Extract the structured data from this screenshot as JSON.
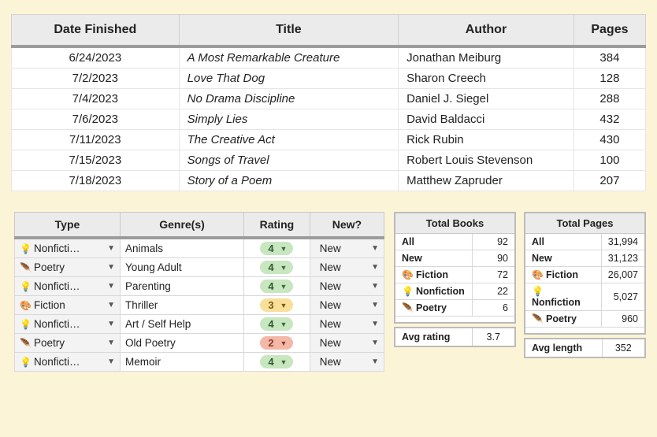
{
  "main_table": {
    "headers": {
      "date": "Date Finished",
      "title": "Title",
      "author": "Author",
      "pages": "Pages"
    },
    "rows": [
      {
        "date": "6/24/2023",
        "title": "A Most Remarkable Creature",
        "author": "Jonathan Meiburg",
        "pages": "384"
      },
      {
        "date": "7/2/2023",
        "title": "Love That Dog",
        "author": "Sharon Creech",
        "pages": "128"
      },
      {
        "date": "7/4/2023",
        "title": "No Drama Discipline",
        "author": "Daniel J. Siegel",
        "pages": "288"
      },
      {
        "date": "7/6/2023",
        "title": "Simply Lies",
        "author": "David Baldacci",
        "pages": "432"
      },
      {
        "date": "7/11/2023",
        "title": "The Creative Act",
        "author": "Rick Rubin",
        "pages": "430"
      },
      {
        "date": "7/15/2023",
        "title": "Songs of Travel",
        "author": "Robert Louis Stevenson",
        "pages": "100"
      },
      {
        "date": "7/18/2023",
        "title": "Story of a Poem",
        "author": "Matthew Zapruder",
        "pages": "207"
      }
    ]
  },
  "types_table": {
    "headers": {
      "type": "Type",
      "genre": "Genre(s)",
      "rating": "Rating",
      "new": "New?"
    },
    "rows": [
      {
        "icon": "💡",
        "type": "Nonficti…",
        "genre": "Animals",
        "rating": "4",
        "rclass": "r4",
        "new": "New"
      },
      {
        "icon": "🪶",
        "type": "Poetry",
        "genre": "Young Adult",
        "rating": "4",
        "rclass": "r4",
        "new": "New"
      },
      {
        "icon": "💡",
        "type": "Nonficti…",
        "genre": "Parenting",
        "rating": "4",
        "rclass": "r4",
        "new": "New"
      },
      {
        "icon": "🎨",
        "type": "Fiction",
        "genre": "Thriller",
        "rating": "3",
        "rclass": "r3",
        "new": "New"
      },
      {
        "icon": "💡",
        "type": "Nonficti…",
        "genre": "Art / Self Help",
        "rating": "4",
        "rclass": "r4",
        "new": "New"
      },
      {
        "icon": "🪶",
        "type": "Poetry",
        "genre": "Old Poetry",
        "rating": "2",
        "rclass": "r2",
        "new": "New"
      },
      {
        "icon": "💡",
        "type": "Nonficti…",
        "genre": "Memoir",
        "rating": "4",
        "rclass": "r4",
        "new": "New"
      }
    ]
  },
  "stats": {
    "books": {
      "header": "Total Books",
      "rows": [
        {
          "icon": "",
          "label": "All",
          "value": "92"
        },
        {
          "icon": "",
          "label": "New",
          "value": "90"
        },
        {
          "icon": "🎨",
          "label": "Fiction",
          "value": "72"
        },
        {
          "icon": "💡",
          "label": "Nonfiction",
          "value": "22"
        },
        {
          "icon": "🪶",
          "label": "Poetry",
          "value": "6"
        }
      ],
      "avg_label": "Avg rating",
      "avg_value": "3.7"
    },
    "pages": {
      "header": "Total Pages",
      "rows": [
        {
          "icon": "",
          "label": "All",
          "value": "31,994"
        },
        {
          "icon": "",
          "label": "New",
          "value": "31,123"
        },
        {
          "icon": "🎨",
          "label": "Fiction",
          "value": "26,007"
        },
        {
          "icon": "💡",
          "label": "Nonfiction",
          "value": "5,027"
        },
        {
          "icon": "🪶",
          "label": "Poetry",
          "value": "960"
        }
      ],
      "avg_label": "Avg length",
      "avg_value": "352"
    }
  }
}
